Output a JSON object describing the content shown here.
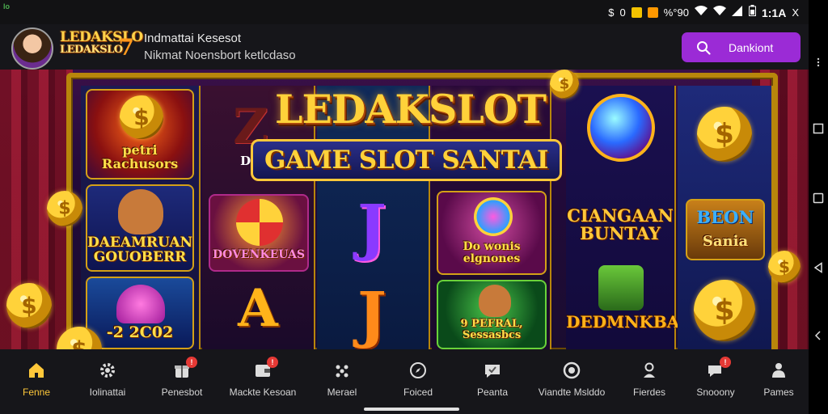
{
  "status_bar": {
    "notification_label": "lo",
    "icons": [
      "dollar-icon",
      "shield-icon",
      "alarm-icon",
      "percent-icon",
      "wifi-icon",
      "wifi-icon",
      "signal-icon",
      "battery-icon"
    ],
    "icon_glyphs": [
      "$",
      "0",
      "□",
      "%"
    ],
    "signal_text": "%°90",
    "clock": "1:1A",
    "close": "X"
  },
  "header": {
    "logo_line1": "LEDAKSLO",
    "logo_line2": "LEDAKSLO",
    "logo_seven": "7",
    "title": "Indmattai Kesesot",
    "subtitle": "Nikmat Noensbort ketlcdaso",
    "action_button_label": "Dankiont",
    "action_button_icon": "search-icon"
  },
  "banner": {
    "headline": "LEDAKSLOT",
    "subheadline": "GAME SLOT SANTAI",
    "col1": {
      "tile1_label": "petri Rachusors",
      "tile2_label": "DAEAMRUAN GOUOBERR",
      "tile3_label": "-2 2C02"
    },
    "col2": {
      "symbol_top": "Z",
      "top_label": "Dano",
      "tile_label": "DOVENKEUAS",
      "symbol_bottom": "A"
    },
    "col3": {
      "symbol_top": "J",
      "symbol_bottom": "J"
    },
    "col4": {
      "tile1_label": "Do wonis elgnones",
      "tile2_label": "9 PEFRAL, Sessasbcs"
    },
    "col5": {
      "label_top": "CIANGAAN BUNTAY",
      "label_bottom": "DEDMNKBA"
    },
    "col6": {
      "sign_line1": "BEON",
      "sign_line2": "Sania"
    }
  },
  "bottom_nav": {
    "items": [
      {
        "label": "Fenne",
        "icon": "home-icon",
        "active": true,
        "badge": ""
      },
      {
        "label": "Iolinattai",
        "icon": "gear-icon",
        "active": false,
        "badge": ""
      },
      {
        "label": "Penesbot",
        "icon": "gift-icon",
        "active": false,
        "badge": "!"
      },
      {
        "label": "Mackte Kesoan",
        "icon": "wallet-icon",
        "active": false,
        "badge": "!"
      },
      {
        "label": "Merael",
        "icon": "dots-icon",
        "active": false,
        "badge": ""
      },
      {
        "label": "Foiced",
        "icon": "compass-icon",
        "active": false,
        "badge": ""
      },
      {
        "label": "Peanta",
        "icon": "chat-check-icon",
        "active": false,
        "badge": ""
      },
      {
        "label": "Viandte Mslddo",
        "icon": "user-circle-icon",
        "active": false,
        "badge": ""
      },
      {
        "label": "Fierdes",
        "icon": "person-icon",
        "active": false,
        "badge": ""
      },
      {
        "label": "Snooony",
        "icon": "chat-bubble-icon",
        "active": false,
        "badge": "!"
      },
      {
        "label": "Pames",
        "icon": "profile-icon",
        "active": false,
        "badge": ""
      }
    ]
  },
  "colors": {
    "accent_purple": "#9b2bd6",
    "active_gold": "#ffc83a",
    "badge_red": "#e53935",
    "frame_gold": "#b8860b"
  }
}
